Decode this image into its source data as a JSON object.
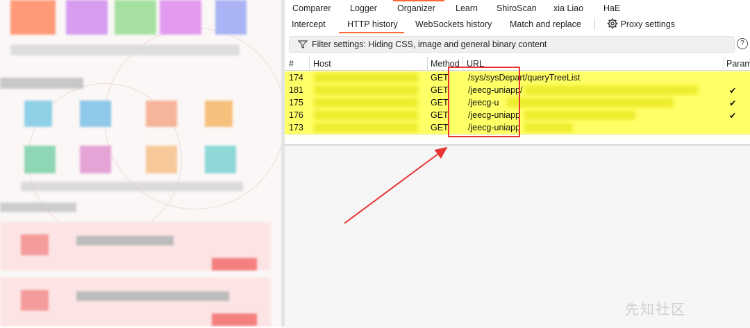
{
  "tabs_top": [
    "Comparer",
    "Logger",
    "Organizer",
    "Learn",
    "ShiroScan",
    "xia Liao",
    "HaE"
  ],
  "tabs_proxy": [
    "Intercept",
    "HTTP history",
    "WebSockets history",
    "Match and replace"
  ],
  "active_proxy_tab": "HTTP history",
  "proxy_settings_label": "Proxy settings",
  "filter_text": "Filter settings: Hiding CSS, image and general binary content",
  "help_glyph": "?",
  "columns": [
    "#",
    "Host",
    "Method",
    "URL",
    "Param"
  ],
  "rows": [
    {
      "num": "174",
      "method": "GET",
      "url": "/sys/sysDepart/queryTreeList",
      "param": ""
    },
    {
      "num": "181",
      "method": "GET",
      "url": "/jeecg-uniapp/",
      "param": "✔"
    },
    {
      "num": "175",
      "method": "GET",
      "url": "/jeecg-u",
      "param": "✔"
    },
    {
      "num": "176",
      "method": "GET",
      "url": "/jeecg-uniapp",
      "param": "✔"
    },
    {
      "num": "173",
      "method": "GET",
      "url": "/jeecg-uniapp",
      "param": ""
    }
  ],
  "watermark": "先知社区",
  "colors": {
    "highlight": "#ffff66",
    "accent": "#ff6633",
    "annotation": "#e83434"
  },
  "icons": {
    "filter": "filter-icon",
    "settings": "gear-icon",
    "help": "help-icon"
  }
}
